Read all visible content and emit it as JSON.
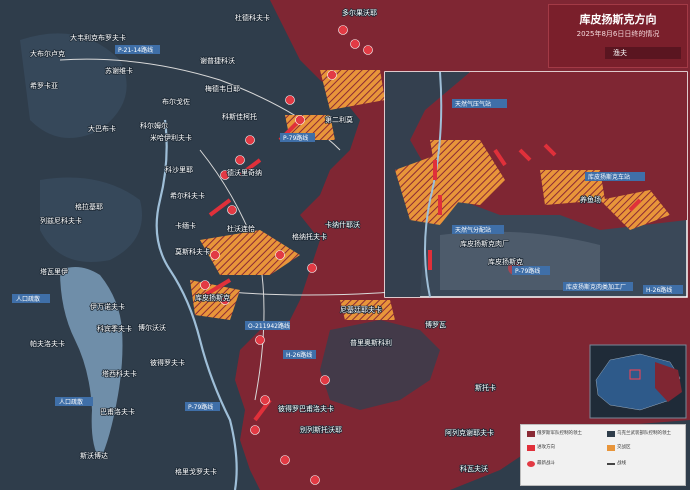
{
  "title": {
    "main": "库皮扬斯克方向",
    "date_line": "2025年8月6日日终的情况",
    "logo_text": "渔夫"
  },
  "colors": {
    "ru_control": "#8a2a35",
    "ua_control": "#2f3d4b",
    "contested": "#e8953a",
    "river": "#9fbfd8",
    "attack_arrow": "#e0303a"
  },
  "places": {
    "p1": "多尔果沃耶",
    "p2": "杜德科夫卡",
    "p3": "大韦利克布罗夫卡",
    "p4": "大布尔卢克",
    "p5": "苏谢维卡",
    "p6": "希罗卡亚",
    "p7": "布尔戈佐",
    "p8": "谢普捷科沃",
    "p9": "梅德韦日耶",
    "p10": "科尔姆尔",
    "p11": "大巴布卡",
    "p12": "米哈伊利夫卡",
    "p13": "科沙里耶",
    "p14": "第二利莫",
    "p15": "科斯佳柯托",
    "p16": "德沃里奇纳",
    "p17": "希尔科夫卡",
    "p18": "格拉基耶",
    "p19": "列兹尼科夫卡",
    "p20": "卡缅卡",
    "p21": "杜沃连恰",
    "p22": "格纳托夫卡",
    "p23": "卡纳什耶沃",
    "p24": "塔瓦里伊",
    "p25": "莫斯科夫卡",
    "p26": "伊万诺夫卡",
    "p27": "科宾季夫卡",
    "p28": "帕夫洛夫卡",
    "p29": "博尔沃沃",
    "p30": "彼得罗夫卡",
    "p31": "塔西科夫卡",
    "p32": "巴甫洛夫卡",
    "p33": "斯沃博达",
    "p34": "格里戈罗夫卡",
    "p35": "尼基廷耶夫卡",
    "p36": "普里奥斯科利",
    "p37": "博罗瓦",
    "p38": "斯托卡",
    "p39": "阿列克谢耶夫卡",
    "p40": "科瓦夫沃",
    "p41": "库皮扬斯克",
    "p42": "彼得罗巴甫洛夫卡",
    "p43": "别列斯托沃耶",
    "p44": "库皮扬斯克货运站"
  },
  "roads": {
    "r1": "P-21-14路线",
    "r2": "P-79路线",
    "r3": "O-211942路线",
    "r4": "H-26路线",
    "r5": "P-79路线"
  },
  "reservoirs": {
    "res1": "人口疏散",
    "res2": "人口疏散"
  },
  "inset": {
    "title_a": "天然气压气站",
    "label_b": "库皮扬斯克车站",
    "label_c": "养鱼场",
    "label_d": "天然气分配站",
    "label_e": "库皮扬斯克肉厂",
    "label_f": "库皮扬斯克",
    "label_g": "库皮扬斯克肉类加工厂",
    "label_h": "P-79路线",
    "label_i": "H-26路线"
  },
  "legend": {
    "item1": "俄罗斯军队控制的领土",
    "item2": "乌克兰武装部队控制的领土",
    "item3": "进攻方向",
    "item4": "交战区",
    "item5": "最新战斗",
    "item6": "战线"
  }
}
